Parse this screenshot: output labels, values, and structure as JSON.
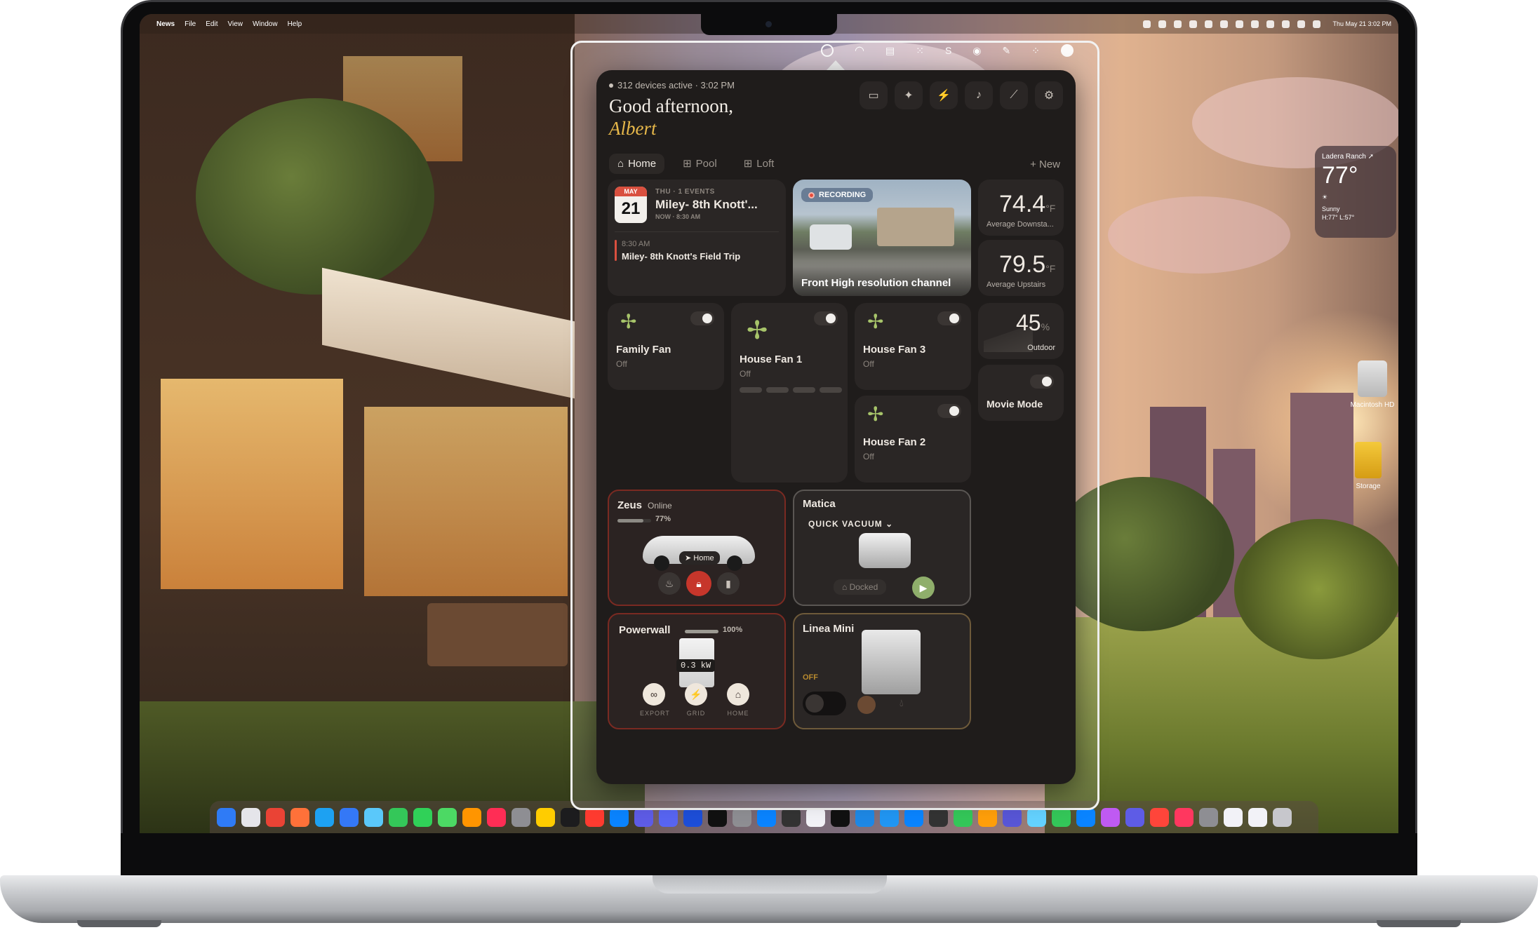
{
  "menubar": {
    "app": "News",
    "menus": [
      "File",
      "Edit",
      "View",
      "Window",
      "Help"
    ],
    "clock": "Thu May 21  3:02 PM"
  },
  "weather_widget": {
    "location": "Ladera Ranch ➚",
    "temperature": "77°",
    "condition": "Sunny",
    "high_low": "H:77° L:57°"
  },
  "desktop": {
    "items": [
      {
        "label": "Macintosh HD",
        "icon": "hard-drive-icon"
      },
      {
        "label": "Storage",
        "icon": "usb-drive-icon"
      }
    ]
  },
  "popover": {
    "status": "312 devices active · 3:02 PM",
    "greeting": "Good afternoon,",
    "name": "Albert",
    "tools": [
      "display-icon",
      "sparkle-icon",
      "bolt-icon",
      "music-note-icon",
      "wand-icon",
      "gear-icon"
    ],
    "tabs": [
      {
        "label": "Home",
        "icon": "house-icon",
        "active": true
      },
      {
        "label": "Pool",
        "icon": "grid-icon",
        "active": false
      },
      {
        "label": "Loft",
        "icon": "grid-icon",
        "active": false
      }
    ],
    "new_label": "+ New",
    "calendar": {
      "month": "MAY",
      "day": "21",
      "meta": "THU · 1 EVENTS",
      "headline": "Miley- 8th Knott'...",
      "headline_time": "NOW · 8:30 AM",
      "event_time": "8:30 AM",
      "event_title": "Miley- 8th Knott's Field Trip"
    },
    "camera": {
      "badge": "RECORDING",
      "label": "Front High resolution channel"
    },
    "stats": [
      {
        "value": "74.4",
        "unit": "°F",
        "label": "Average Downsta..."
      },
      {
        "value": "79.5",
        "unit": "°F",
        "label": "Average Upstairs"
      },
      {
        "value": "45",
        "unit": "%",
        "label": "Outdoor"
      }
    ],
    "fans": [
      {
        "name": "Family Fan",
        "state": "Off"
      },
      {
        "name": "House Fan 1",
        "state": "Off"
      },
      {
        "name": "House Fan 3",
        "state": "Off"
      },
      {
        "name": "House Fan 2",
        "state": "Off"
      }
    ],
    "movie_mode": {
      "label": "Movie Mode"
    },
    "car": {
      "name": "Zeus",
      "status": "Online",
      "battery": "77%",
      "battery_fraction": 0.77,
      "location": "Home"
    },
    "vacuum": {
      "name": "Matica",
      "mode": "QUICK VACUUM",
      "state": "Docked"
    },
    "powerwall": {
      "name": "Powerwall",
      "charge": "100%",
      "charge_fraction": 1.0,
      "power": "0.3 kW",
      "buttons": [
        "EXPORT",
        "GRID",
        "HOME"
      ]
    },
    "espresso": {
      "name": "Linea Mini",
      "state": "OFF"
    }
  },
  "colors": {
    "accent_gold": "#e7b84a",
    "panel_bg": "#1f1c1b",
    "card_bg": "#2a2625",
    "fan_green": "#a7c46a",
    "recording_red": "#e64b3b"
  }
}
